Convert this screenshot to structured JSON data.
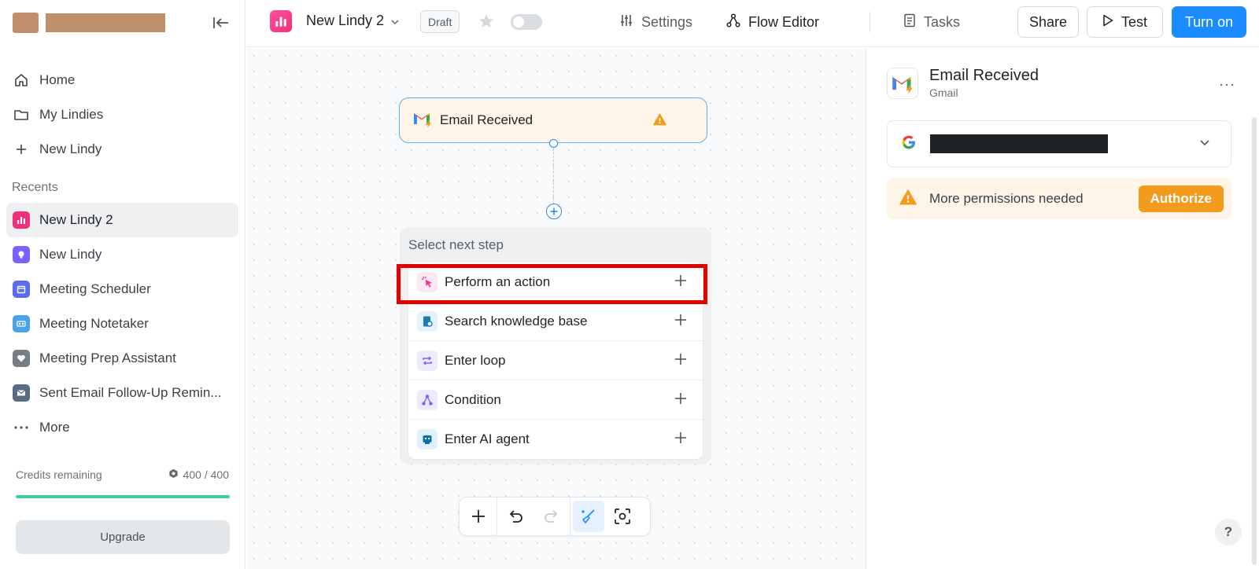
{
  "sidebar": {
    "nav": [
      {
        "label": "Home",
        "icon": "home-icon"
      },
      {
        "label": "My Lindies",
        "icon": "folder-icon"
      },
      {
        "label": "New Lindy",
        "icon": "plus-icon"
      }
    ],
    "recents_label": "Recents",
    "recents": [
      {
        "label": "New Lindy 2",
        "icon": "chart-icon",
        "color": "#f0307a"
      },
      {
        "label": "New Lindy",
        "icon": "bulb-icon",
        "color": "#7b61ff"
      },
      {
        "label": "Meeting Scheduler",
        "icon": "calendar-icon",
        "color": "#5b6cf0"
      },
      {
        "label": "Meeting Notetaker",
        "icon": "recorder-icon",
        "color": "#4aa3e8"
      },
      {
        "label": "Meeting Prep Assistant",
        "icon": "heart-icon",
        "color": "#777d85"
      },
      {
        "label": "Sent Email Follow-Up Remin...",
        "icon": "envelope-icon",
        "color": "#5a6b85"
      }
    ],
    "more_label": "More",
    "credits_label": "Credits remaining",
    "credits_value": "400 / 400",
    "credits_fraction": 1.0,
    "upgrade_label": "Upgrade"
  },
  "header": {
    "lindy_title": "New Lindy 2",
    "draft_label": "Draft",
    "settings_label": "Settings",
    "flow_editor_label": "Flow Editor",
    "tasks_label": "Tasks",
    "share_label": "Share",
    "test_label": "Test",
    "turn_on_label": "Turn on"
  },
  "canvas": {
    "trigger_label": "Email Received",
    "step_title": "Select next step",
    "steps": [
      {
        "label": "Perform an action",
        "icon": "cursor-sparkle-icon",
        "color": "#e8348a"
      },
      {
        "label": "Search knowledge base",
        "icon": "book-search-icon",
        "color": "#1a7fb0"
      },
      {
        "label": "Enter loop",
        "icon": "loop-icon",
        "color": "#7b61ff"
      },
      {
        "label": "Condition",
        "icon": "branch-icon",
        "color": "#7b61ff"
      },
      {
        "label": "Enter AI agent",
        "icon": "robot-icon",
        "color": "#0e6fa8"
      }
    ]
  },
  "panel": {
    "title": "Email Received",
    "subtitle": "Gmail",
    "more_label": "···",
    "permission_text": "More permissions needed",
    "authorize_label": "Authorize",
    "help_label": "?"
  },
  "colors": {
    "accent": "#1a8cff",
    "warning": "#f39b1c",
    "credits": "#3ecf98"
  }
}
